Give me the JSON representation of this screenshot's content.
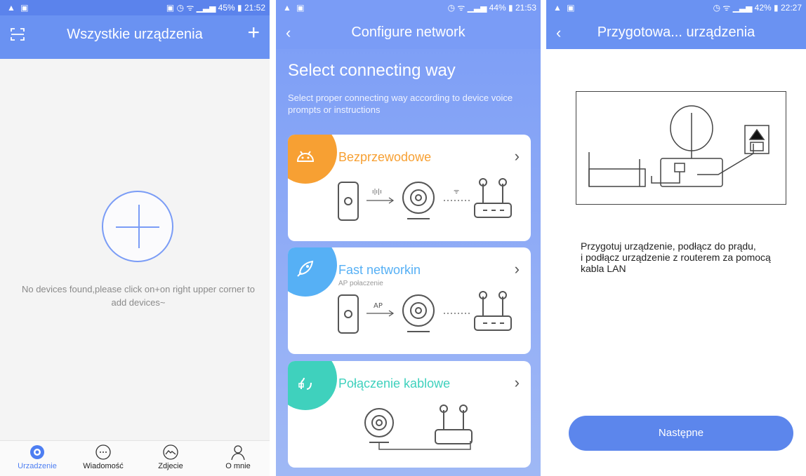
{
  "screens": [
    {
      "status": {
        "left": "▲ ▣",
        "right": "▣ ◷ ᯤ ▁▃▅ 45% ▮ 21:52"
      },
      "nav": {
        "title": "Wszystkie urządzenia",
        "left_icon": "scan-icon",
        "right_icon": "plus-icon"
      },
      "empty_message": "No devices found,please click on+on right upper corner to add devices~",
      "tabs": [
        {
          "label": "Urzadzenie",
          "icon": "camera-icon",
          "active": true
        },
        {
          "label": "Wiadomość",
          "icon": "message-icon",
          "active": false
        },
        {
          "label": "Zdjecie",
          "icon": "photo-icon",
          "active": false
        },
        {
          "label": "O mnie",
          "icon": "person-icon",
          "active": false
        }
      ]
    },
    {
      "status": {
        "left": "▲ ▣",
        "right": "◷ ᯤ ▁▃▅ 44% ▮ 21:53"
      },
      "nav": {
        "title": "Configure network",
        "left_icon": "back-icon"
      },
      "heading": "Select connecting way",
      "subheading": "Select proper connecting way according to device voice prompts or instructions",
      "options": [
        {
          "label": "Bezprzewodowe",
          "sub": "",
          "color": "#f7a033",
          "icon": "android-icon",
          "mid_label": "",
          "mid_icon": "sound-wave-icon"
        },
        {
          "label": "Fast networkin",
          "sub": "AP połaczenie",
          "color": "#56b0f5",
          "icon": "rocket-icon",
          "mid_label": "AP",
          "mid_icon": ""
        },
        {
          "label": "Połączenie kablowe",
          "sub": "",
          "color": "#3fd1bd",
          "icon": "cable-icon",
          "mid_label": "",
          "mid_icon": ""
        }
      ]
    },
    {
      "status": {
        "left": "▲ ▣",
        "right": "◷ ᯤ ▁▃▅ 42% ▮ 22:27"
      },
      "nav": {
        "title": "Przygotowa... urządzenia",
        "left_icon": "back-icon"
      },
      "instruction": "Przygotuj urządzenie, podłącz do prądu,\n i podłącz urządzenie z routerem za pomocą\nkabla LAN",
      "next_label": "Następne"
    }
  ]
}
